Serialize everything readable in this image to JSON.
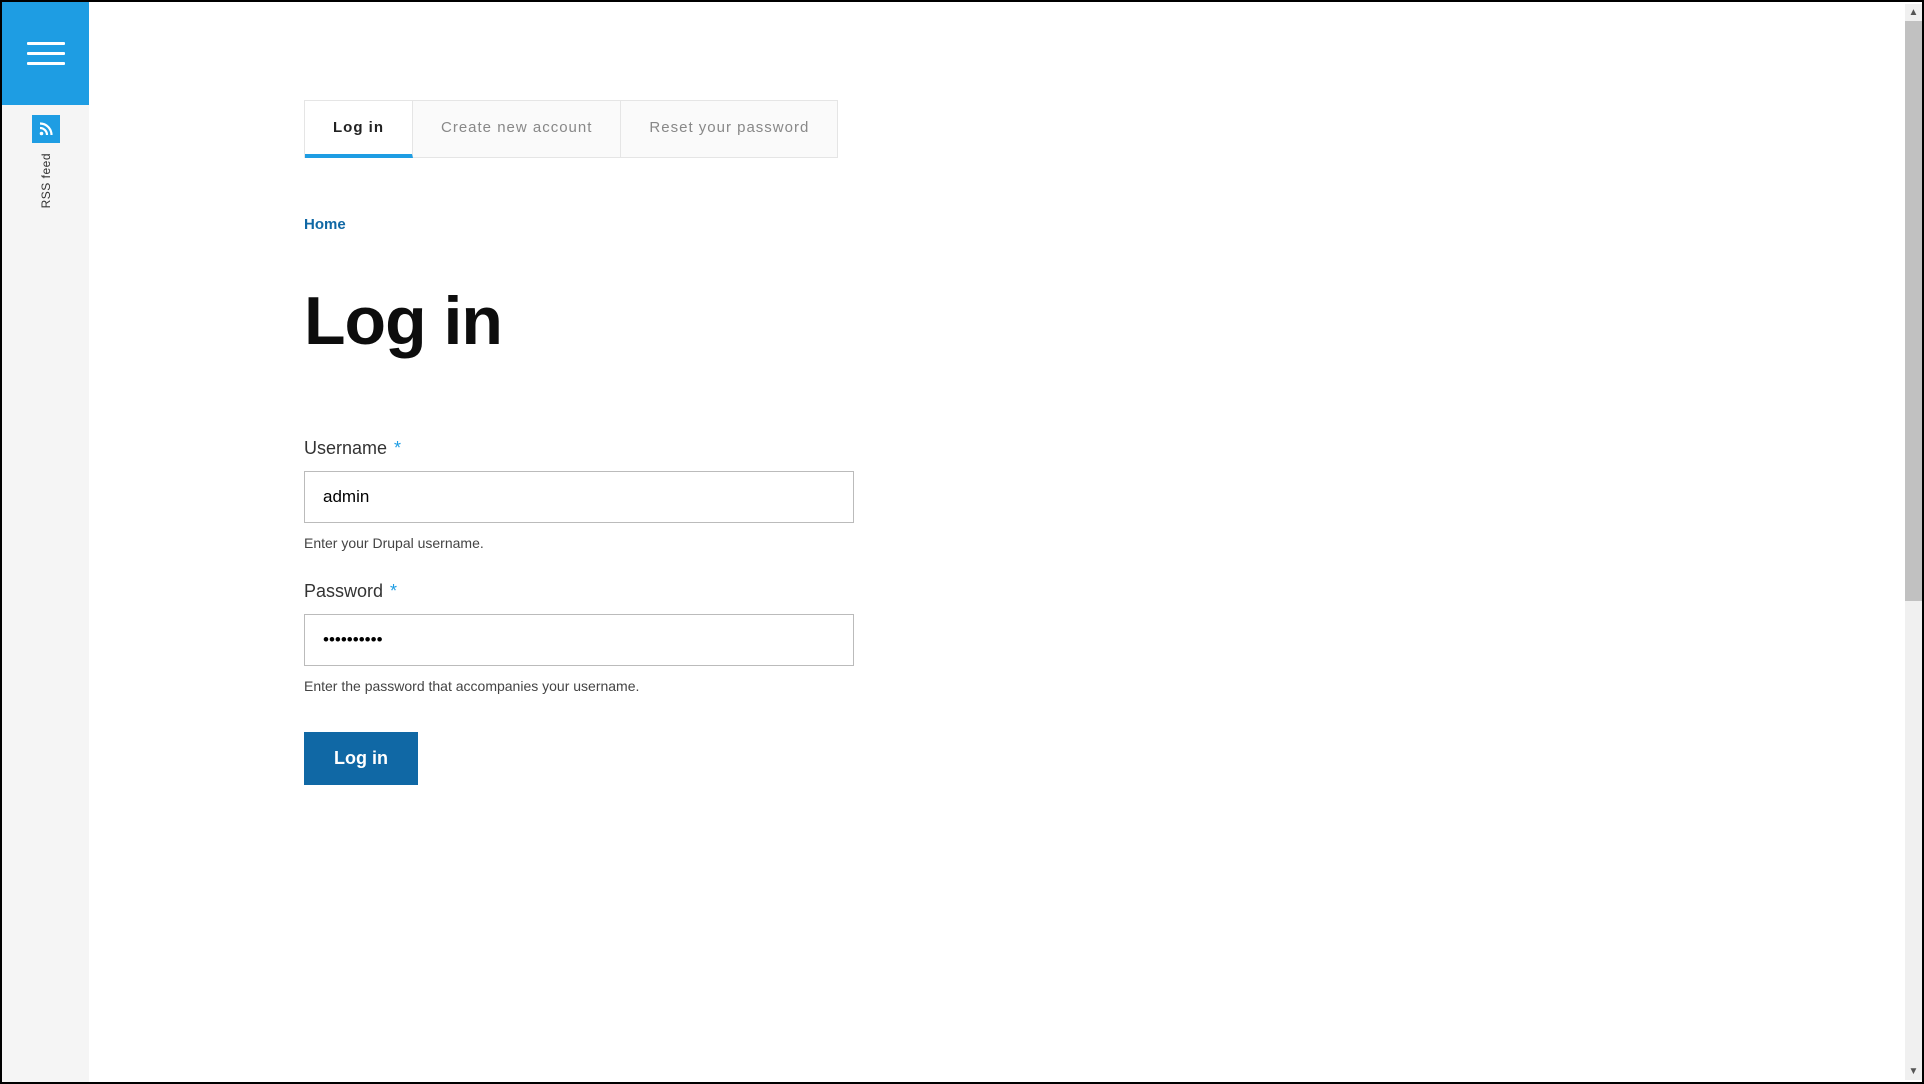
{
  "sidebar": {
    "rss_label": "RSS feed"
  },
  "tabs": [
    {
      "label": "Log in",
      "active": true
    },
    {
      "label": "Create new account",
      "active": false
    },
    {
      "label": "Reset your password",
      "active": false
    }
  ],
  "breadcrumb": {
    "home": "Home"
  },
  "page": {
    "title": "Log in"
  },
  "form": {
    "username": {
      "label": "Username",
      "value": "admin",
      "help": "Enter your Drupal username."
    },
    "password": {
      "label": "Password",
      "value": "••••••••••",
      "help": "Enter the password that accompanies your username."
    },
    "submit_label": "Log in"
  }
}
